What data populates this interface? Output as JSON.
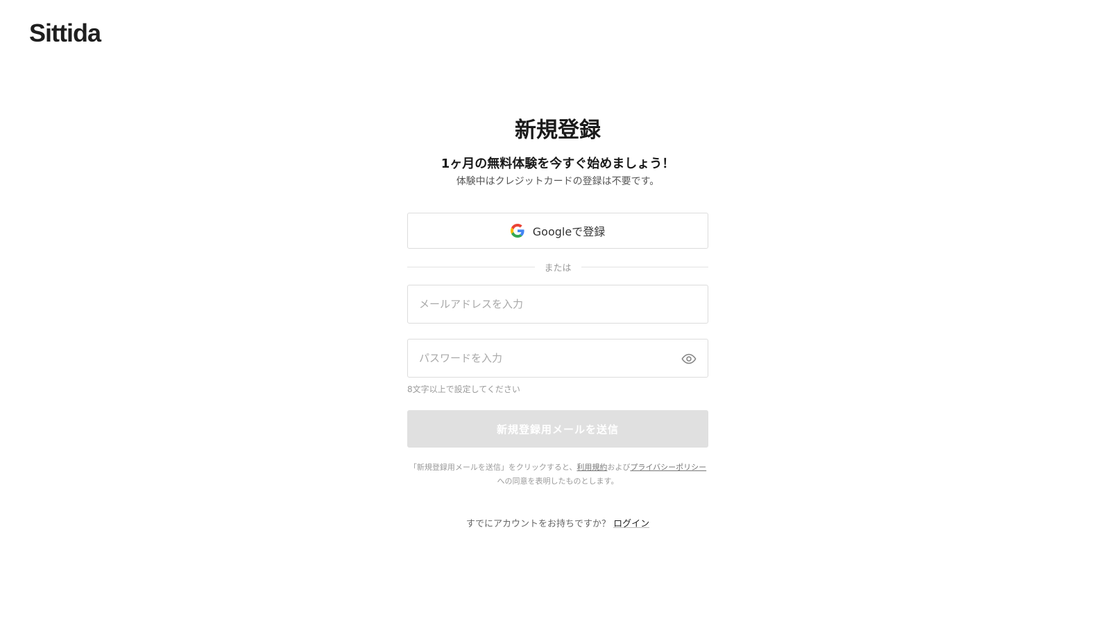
{
  "header": {
    "logo_text": "Sittida"
  },
  "signup": {
    "title": "新規登録",
    "subtitle": "1ヶ月の無料体験を今すぐ始めましょう！",
    "note": "体験中はクレジットカードの登録は不要です。",
    "google_button": {
      "label": "Googleで登録",
      "icon": "google-g-icon"
    },
    "divider_text": "または",
    "email": {
      "placeholder": "メールアドレスを入力",
      "value": ""
    },
    "password": {
      "placeholder": "パスワードを入力",
      "value": "",
      "toggle_icon": "eye-icon"
    },
    "password_hint": "8文字以上で設定してください",
    "submit_label": "新規登録用メールを送信",
    "submit_enabled": false,
    "terms": {
      "prefix": "「新規登録用メールを送信」をクリックすると、",
      "terms_link": "利用規約",
      "middle": "および",
      "privacy_link": "プライバシーポリシー",
      "suffix": "への同意を表明したものとします。"
    },
    "login": {
      "prompt": "すでにアカウントをお持ちですか？",
      "link_label": "ログイン"
    }
  },
  "colors": {
    "text_primary": "#1a1a1a",
    "text_muted": "#9a9a9a",
    "border": "#dcdcdc",
    "submit_disabled_bg": "#e0e0e0",
    "google_blue": "#4285F4",
    "google_red": "#EA4335",
    "google_yellow": "#FBBC05",
    "google_green": "#34A853"
  }
}
